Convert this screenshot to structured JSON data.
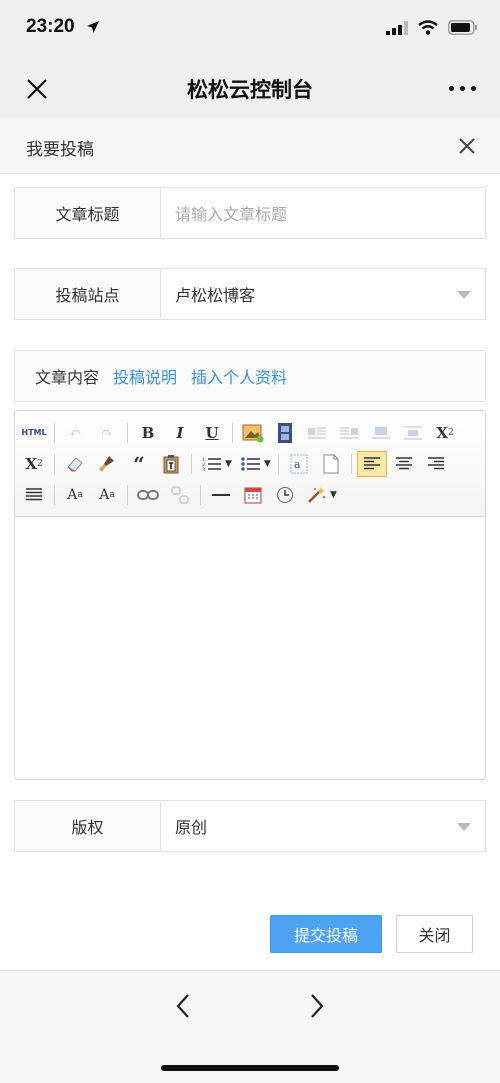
{
  "status": {
    "time": "23:20"
  },
  "nav": {
    "title": "松松云控制台"
  },
  "panel": {
    "title": "我要投稿"
  },
  "form": {
    "title_label": "文章标题",
    "title_placeholder": "请输入文章标题",
    "site_label": "投稿站点",
    "site_value": "卢松松博客",
    "content_label": "文章内容",
    "guide_link": "投稿说明",
    "insert_profile_link": "插入个人资料",
    "copyright_label": "版权",
    "copyright_value": "原创"
  },
  "toolbar": {
    "html_label": "HTML",
    "bold": "B",
    "italic": "I",
    "underline": "U"
  },
  "actions": {
    "submit": "提交投稿",
    "close": "关闭"
  },
  "colors": {
    "primary": "#4ea2f2",
    "link": "#3a8ee6"
  }
}
